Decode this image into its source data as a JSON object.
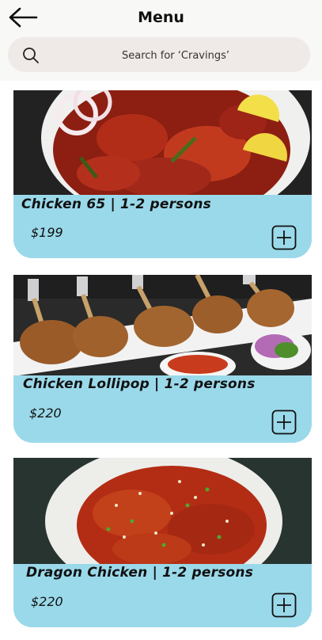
{
  "header": {
    "title": "Menu",
    "back_icon": "arrow-left-icon"
  },
  "search": {
    "placeholder": "Search for ‘Cravings’",
    "icon": "search-icon"
  },
  "items": [
    {
      "name": "Chicken 65  | 1-2 persons",
      "price": "$199",
      "image": "chicken-65-photo"
    },
    {
      "name": "Chicken Lollipop  | 1-2 persons",
      "price": "$220",
      "image": "chicken-lollipop-photo"
    },
    {
      "name": "Dragon Chicken | 1-2 persons",
      "price": "$220",
      "image": "dragon-chicken-photo"
    }
  ],
  "colors": {
    "card_background": "#9ad9ea",
    "search_background": "#efe9e7",
    "header_background": "#f8f8f6"
  }
}
